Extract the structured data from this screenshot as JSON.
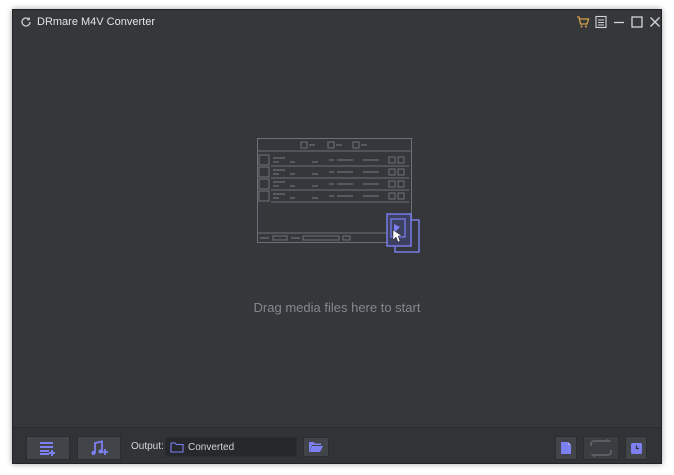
{
  "window": {
    "title": "DRmare M4V Converter"
  },
  "icons": {
    "app": "refresh-circle-icon",
    "cart": "cart-icon",
    "menu": "menu-list-icon",
    "minimize": "minimize-icon",
    "maximize": "maximize-icon",
    "close": "close-icon",
    "add_files": "add-files-icon",
    "add_audio": "add-audio-icon",
    "folder": "folder-icon",
    "browse": "open-folder-icon",
    "format": "format-file-icon",
    "convert": "convert-icon",
    "history": "history-icon"
  },
  "main": {
    "hint": "Drag media files here to start"
  },
  "bottom": {
    "output_label": "Output:",
    "output_value": "Converted"
  },
  "colors": {
    "accent": "#7c80f2",
    "background": "#35373a",
    "cart": "#d9a24c"
  }
}
